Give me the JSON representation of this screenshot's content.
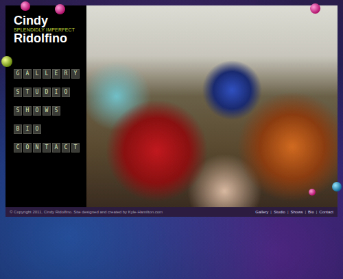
{
  "logo": {
    "first": "Cindy",
    "tagline": "SPLENDIDLY IMPERFECT",
    "last": "Ridolfino"
  },
  "nav": [
    {
      "label": "GALLERY"
    },
    {
      "label": "STUDIO"
    },
    {
      "label": "SHOWS"
    },
    {
      "label": "BIO"
    },
    {
      "label": "CONTACT"
    }
  ],
  "footer": {
    "copyright": "© Copyright 2011, Cindy Ridolfino. Site designed and created by Kyle-Hamilton.com",
    "links": [
      "Gallery",
      "Studio",
      "Shows",
      "Bio",
      "Contact"
    ],
    "separator": "|"
  }
}
